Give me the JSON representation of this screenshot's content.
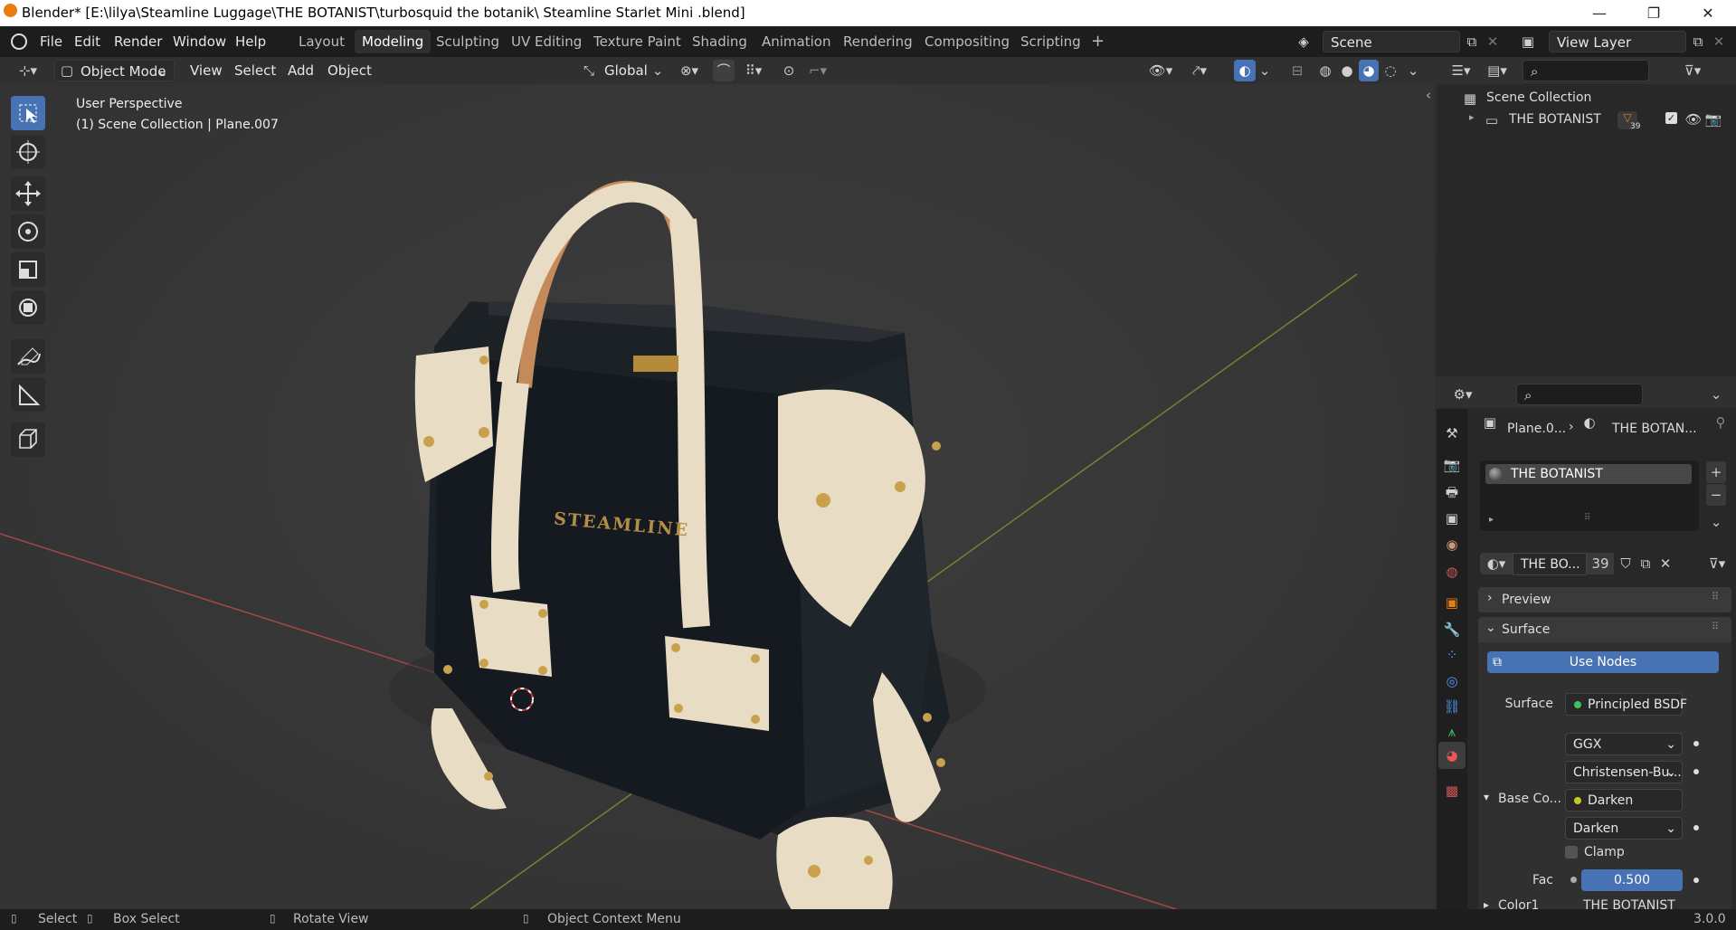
{
  "window": {
    "title": "Blender* [E:\\lilya\\Steamline Luggage\\THE BOTANIST\\turbosquid the botanik\\ Steamline Starlet Mini .blend]",
    "controls": {
      "minimize": "—",
      "restore": "❐",
      "close": "✕"
    }
  },
  "menu": [
    "File",
    "Edit",
    "Render",
    "Window",
    "Help"
  ],
  "workspace_tabs": [
    "Layout",
    "Modeling",
    "Sculpting",
    "UV Editing",
    "Texture Paint",
    "Shading",
    "Animation",
    "Rendering",
    "Compositing",
    "Scripting"
  ],
  "active_tab": "Modeling",
  "add_tab": "+",
  "scene": {
    "name": "Scene",
    "view_layer": "View Layer"
  },
  "viewport_header": {
    "mode": "Object Mode",
    "menus": [
      "View",
      "Select",
      "Add",
      "Object"
    ],
    "transform": "Global"
  },
  "viewport": {
    "perspective": "User Perspective",
    "collection_info": "(1) Scene Collection | Plane.007",
    "model_label": "STEAMLINE"
  },
  "outliner": {
    "root": "Scene Collection",
    "items": [
      {
        "name": "THE BOTANIST",
        "count": "39"
      }
    ]
  },
  "properties": {
    "breadcrumb_object": "Plane.0...",
    "breadcrumb_material": "THE BOTAN...",
    "material_slot": "THE BOTANIST",
    "material_name": "THE BO...",
    "material_users": "39",
    "panels": {
      "preview": "Preview",
      "surface": "Surface"
    },
    "use_nodes": "Use Nodes",
    "surface_label": "Surface",
    "surface_value": "Principled BSDF",
    "distribution": "GGX",
    "subsurface_method": "Christensen-Bu...",
    "base_color_label": "Base Co...",
    "base_color_node": "Darken",
    "blend_mode": "Darken",
    "clamp_label": "Clamp",
    "fac_label": "Fac",
    "fac_value": "0.500",
    "color1_label": "Color1",
    "color1_value": "THE BOTANIST"
  },
  "statusbar": {
    "select": "Select",
    "box_select": "Box Select",
    "rotate": "Rotate View",
    "context": "Object Context Menu",
    "version": "3.0.0"
  },
  "colors": {
    "accent": "#4772b3",
    "header": "#1d1d1d",
    "panel": "#282828",
    "viewport": "#393939"
  }
}
